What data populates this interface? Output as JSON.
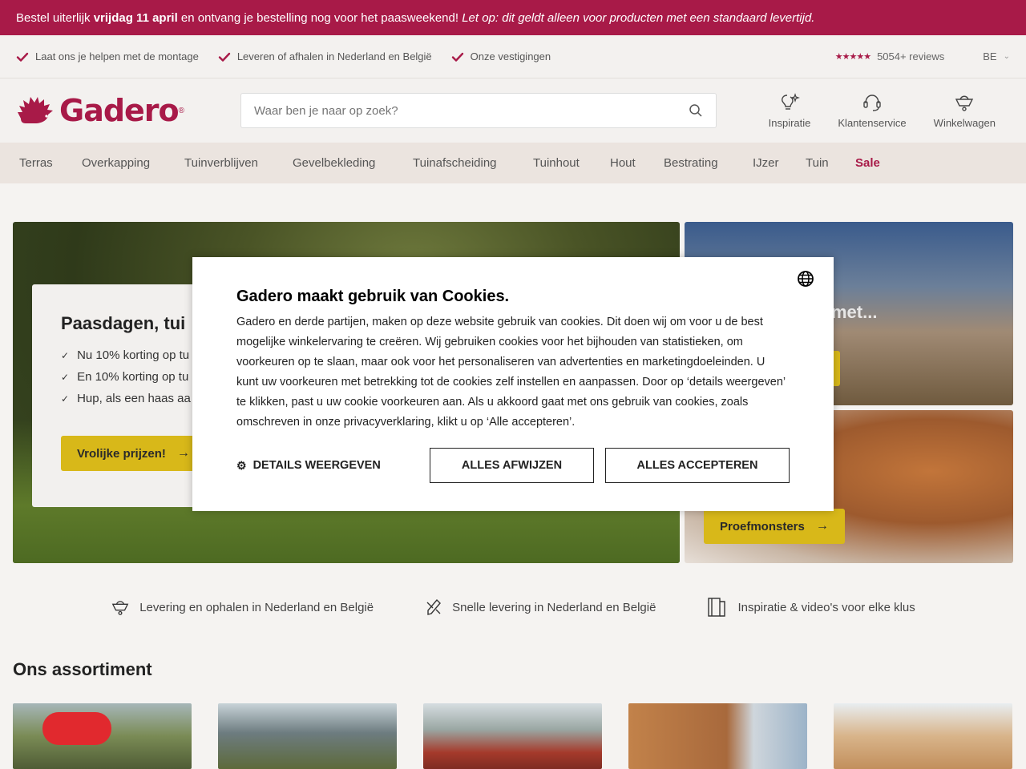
{
  "promo": {
    "part1": "Bestel uiterlijk ",
    "bold": "vrijdag 11 april",
    "part2": " en ontvang je bestelling nog voor het paasweekend! ",
    "italic": "Let op: dit geldt alleen voor producten met een standaard levertijd."
  },
  "usp": {
    "items": [
      "Laat ons je helpen met de montage",
      "Leveren of afhalen in Nederland en België",
      "Onze vestigingen"
    ],
    "stars": "★★★★★",
    "reviews": "5054+ reviews",
    "language": "BE"
  },
  "header": {
    "logo": "Gadero",
    "logo_reg": "®",
    "search_placeholder": "Waar ben je naar op zoek?",
    "icons": [
      "Inspiratie",
      "Klantenservice",
      "Winkelwagen"
    ]
  },
  "nav": {
    "items": [
      "Terras",
      "Overkapping",
      "Tuinverblijven",
      "Gevelbekleding",
      "Tuinafscheiding",
      "Tuinhout",
      "Hout",
      "Bestrating",
      "IJzer",
      "Tuin"
    ],
    "sale": "Sale"
  },
  "hero": {
    "title": "Paasdagen, tui",
    "list": [
      "Nu 10% korting op tu",
      "En 10% korting op tu",
      "Hup, als een haas aa"
    ],
    "button": "Vrolijke prijzen!",
    "side1_text": "met...",
    "side2_button": "Proefmonsters"
  },
  "cookie": {
    "title": "Gadero maakt gebruik van Cookies.",
    "body": "Gadero en derde partijen, maken op deze website gebruik van cookies. Dit doen wij om voor u de best mogelijke winkelervaring te creëren. Wij gebruiken cookies voor het bijhouden van statistieken, om voorkeuren op te slaan, maar ook voor het personaliseren van advertenties en marketingdoeleinden. U kunt uw voorkeuren met betrekking tot de cookies zelf instellen en aanpassen. Door op ‘details weergeven’ te klikken, past u uw cookie voorkeuren aan. Als u akkoord gaat met ons gebruik van cookies, zoals omschreven in onze privacyverklaring, klikt u op ‘Alle accepteren’.",
    "details": "DETAILS WEERGEVEN",
    "reject": "ALLES AFWIJZEN",
    "accept": "ALLES ACCEPTEREN"
  },
  "usp2": {
    "items": [
      "Levering en ophalen in Nederland en België",
      "Snelle levering in Nederland en België",
      "Inspiratie & video's voor elke klus"
    ]
  },
  "assortiment": {
    "title": "Ons assortiment"
  },
  "colors": {
    "brand": "#a81a48",
    "nav_bg": "#ebe4df",
    "button_yellow": "#d8b819"
  }
}
